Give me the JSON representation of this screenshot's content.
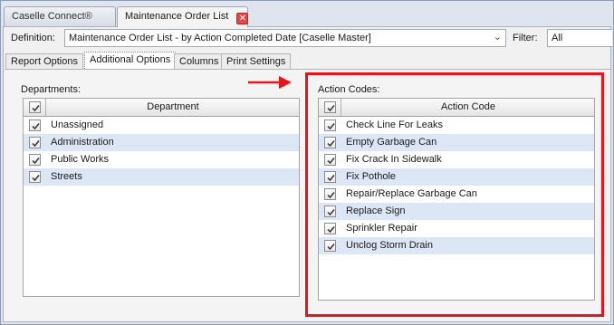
{
  "tabs": [
    {
      "label": "Caselle Connect®",
      "active": false
    },
    {
      "label": "Maintenance Order List",
      "active": true
    }
  ],
  "definition": {
    "label": "Definition:",
    "value": "Maintenance Order List - by Action Completed Date [Caselle Master]"
  },
  "filter": {
    "label": "Filter:",
    "value": "All"
  },
  "subtabs": [
    "Report Options",
    "Additional Options",
    "Columns",
    "Print Settings"
  ],
  "departments": {
    "label": "Departments:",
    "header": "Department",
    "items": [
      "Unassigned",
      "Administration",
      "Public Works",
      "Streets"
    ]
  },
  "action_codes": {
    "label": "Action Codes:",
    "header": "Action Code",
    "items": [
      "Check Line For Leaks",
      "Empty Garbage Can",
      "Fix Crack In Sidewalk",
      "Fix Pothole",
      "Repair/Replace Garbage Can",
      "Replace Sign",
      "Sprinkler Repair",
      "Unclog Storm Drain"
    ]
  },
  "colors": {
    "annotation": "#e8141b",
    "row_alt": "#dce6f5"
  }
}
